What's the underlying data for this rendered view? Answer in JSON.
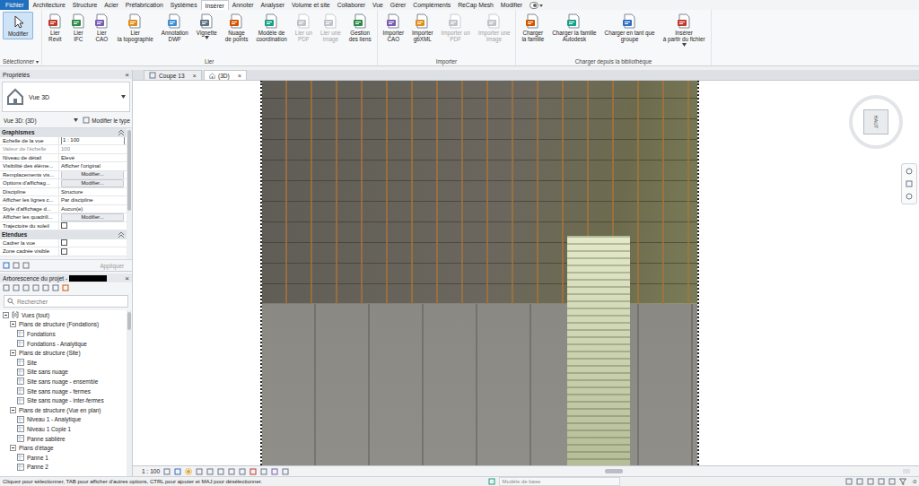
{
  "window": {
    "app": "Revit"
  },
  "menu_tabs": [
    {
      "label": "Fichier",
      "kind": "file",
      "selected": false
    },
    {
      "label": "Architecture",
      "kind": "tab",
      "selected": false
    },
    {
      "label": "Structure",
      "kind": "tab",
      "selected": false
    },
    {
      "label": "Acier",
      "kind": "tab",
      "selected": false
    },
    {
      "label": "Préfabrication",
      "kind": "tab",
      "selected": false
    },
    {
      "label": "Systèmes",
      "kind": "tab",
      "selected": false
    },
    {
      "label": "Insérer",
      "kind": "tab",
      "selected": true
    },
    {
      "label": "Annoter",
      "kind": "tab",
      "selected": false
    },
    {
      "label": "Analyser",
      "kind": "tab",
      "selected": false
    },
    {
      "label": "Volume et site",
      "kind": "tab",
      "selected": false
    },
    {
      "label": "Collaborer",
      "kind": "tab",
      "selected": false
    },
    {
      "label": "Vue",
      "kind": "tab",
      "selected": false
    },
    {
      "label": "Gérer",
      "kind": "tab",
      "selected": false
    },
    {
      "label": "Compléments",
      "kind": "tab",
      "selected": false
    },
    {
      "label": "ReCap Mesh",
      "kind": "tab",
      "selected": false
    },
    {
      "label": "Modifier",
      "kind": "tab",
      "selected": false
    }
  ],
  "ribbon": {
    "panels": [
      {
        "label": "Sélectionner ▾",
        "buttons": [
          {
            "lines": [
              "Modifier"
            ],
            "selected": true,
            "disabled": false,
            "dropdown": false
          }
        ]
      },
      {
        "label": "Lier",
        "buttons": [
          {
            "lines": [
              "Lier",
              "Revit"
            ],
            "selected": false,
            "disabled": false,
            "dropdown": false
          },
          {
            "lines": [
              "Lier",
              "IFC"
            ],
            "selected": false,
            "disabled": false,
            "dropdown": false
          },
          {
            "lines": [
              "Lier",
              "CAO"
            ],
            "selected": false,
            "disabled": false,
            "dropdown": false
          },
          {
            "lines": [
              "Lier",
              "la topographie"
            ],
            "selected": false,
            "disabled": false,
            "dropdown": false
          },
          {
            "lines": [
              "Annotation",
              "DWF"
            ],
            "selected": false,
            "disabled": false,
            "dropdown": false
          },
          {
            "lines": [
              "Vignette"
            ],
            "selected": false,
            "disabled": false,
            "dropdown": true
          },
          {
            "lines": [
              "Nuage",
              "de points"
            ],
            "selected": false,
            "disabled": false,
            "dropdown": false
          },
          {
            "lines": [
              "Modèle de",
              "coordination"
            ],
            "selected": false,
            "disabled": false,
            "dropdown": false
          },
          {
            "lines": [
              "Lier un",
              "PDF"
            ],
            "selected": false,
            "disabled": true,
            "dropdown": false
          },
          {
            "lines": [
              "Lier une",
              "image"
            ],
            "selected": false,
            "disabled": true,
            "dropdown": false
          },
          {
            "lines": [
              "Gestion",
              "des liens"
            ],
            "selected": false,
            "disabled": false,
            "dropdown": false
          }
        ]
      },
      {
        "label": "Importer",
        "buttons": [
          {
            "lines": [
              "Importer",
              "CAO"
            ],
            "selected": false,
            "disabled": false,
            "dropdown": false
          },
          {
            "lines": [
              "Importer",
              "gbXML"
            ],
            "selected": false,
            "disabled": false,
            "dropdown": false
          },
          {
            "lines": [
              "Importer un",
              "PDF"
            ],
            "selected": false,
            "disabled": true,
            "dropdown": false
          },
          {
            "lines": [
              "Importer une",
              "image"
            ],
            "selected": false,
            "disabled": true,
            "dropdown": false
          }
        ]
      },
      {
        "label": "Charger depuis la bibliothèque",
        "buttons": [
          {
            "lines": [
              "Charger",
              "la famille"
            ],
            "selected": false,
            "disabled": false,
            "dropdown": false
          },
          {
            "lines": [
              "Charger la famille",
              "Autodesk"
            ],
            "selected": false,
            "disabled": false,
            "dropdown": false
          },
          {
            "lines": [
              "Charger en tant que",
              "groupe"
            ],
            "selected": false,
            "disabled": false,
            "dropdown": false
          },
          {
            "lines": [
              "Insérer",
              "à partir du fichier"
            ],
            "selected": false,
            "disabled": false,
            "dropdown": true
          }
        ]
      }
    ]
  },
  "properties": {
    "title": "Propriétés",
    "close": "×",
    "type_name": "Vue 3D",
    "view_selector": "Vue 3D: (3D)",
    "edit_type": "Modifier le type",
    "sections": [
      {
        "label": "Graphismes",
        "rows": [
          {
            "kind": "input",
            "label": "Echelle de la vue",
            "value": "1 : 100",
            "disabled": false
          },
          {
            "kind": "text",
            "label": "Valeur de l'échelle",
            "value": "100",
            "disabled": true
          },
          {
            "kind": "text",
            "label": "Niveau de détail",
            "value": "Elevé",
            "disabled": false
          },
          {
            "kind": "text",
            "label": "Visibilité des éléme...",
            "value": "Afficher l'original",
            "disabled": false
          },
          {
            "kind": "button",
            "label": "Remplacements vis...",
            "value": "Modifier...",
            "disabled": false
          },
          {
            "kind": "button",
            "label": "Options d'affichag...",
            "value": "Modifier...",
            "disabled": false
          },
          {
            "kind": "text",
            "label": "Discipline",
            "value": "Structure",
            "disabled": false
          },
          {
            "kind": "text",
            "label": "Afficher les lignes c...",
            "value": "Par discipline",
            "disabled": false
          },
          {
            "kind": "text",
            "label": "Style d'affichage d...",
            "value": "Aucun(e)",
            "disabled": false
          },
          {
            "kind": "button",
            "label": "Afficher les quadrill...",
            "value": "Modifier...",
            "disabled": false
          },
          {
            "kind": "checkbox",
            "label": "Trajectoire du soleil",
            "checked": false,
            "disabled": false
          }
        ]
      },
      {
        "label": "Etendues",
        "rows": [
          {
            "kind": "checkbox",
            "label": "Cadrer la vue",
            "checked": false,
            "disabled": false
          },
          {
            "kind": "checkbox",
            "label": "Zone cadrée visible",
            "checked": false,
            "disabled": false
          }
        ]
      }
    ],
    "apply": "Appliquer",
    "apply_disabled": true
  },
  "project_browser": {
    "title": "Arborescence du projet -",
    "close": "×",
    "search_placeholder": "Rechercher",
    "tree": [
      {
        "label": "Vues (tout)",
        "depth": 0,
        "kind": "root",
        "expanded": true
      },
      {
        "label": "Plans de structure (Fondations)",
        "depth": 1,
        "kind": "group",
        "expanded": true
      },
      {
        "label": "Fondations",
        "depth": 2,
        "kind": "view",
        "expanded": false
      },
      {
        "label": "Fondations - Analytique",
        "depth": 2,
        "kind": "view",
        "expanded": false
      },
      {
        "label": "Plans de structure (Site)",
        "depth": 1,
        "kind": "group",
        "expanded": true
      },
      {
        "label": "Site",
        "depth": 2,
        "kind": "view",
        "expanded": false
      },
      {
        "label": "Site sans nuage",
        "depth": 2,
        "kind": "view",
        "expanded": false
      },
      {
        "label": "Site sans nuage - ensemble",
        "depth": 2,
        "kind": "view",
        "expanded": false
      },
      {
        "label": "Site sans nuage - fermes",
        "depth": 2,
        "kind": "view",
        "expanded": false
      },
      {
        "label": "Site sans nuage - inter-fermes",
        "depth": 2,
        "kind": "view",
        "expanded": false
      },
      {
        "label": "Plans de structure (Vue en plan)",
        "depth": 1,
        "kind": "group",
        "expanded": true
      },
      {
        "label": "Niveau 1 - Analytique",
        "depth": 2,
        "kind": "view",
        "expanded": false
      },
      {
        "label": "Niveau 1 Copie 1",
        "depth": 2,
        "kind": "view",
        "expanded": false
      },
      {
        "label": "Panne sablière",
        "depth": 2,
        "kind": "view",
        "expanded": false
      },
      {
        "label": "Plans d'étage",
        "depth": 1,
        "kind": "group",
        "expanded": true
      },
      {
        "label": "Panne 1",
        "depth": 2,
        "kind": "view",
        "expanded": false
      },
      {
        "label": "Panne 2",
        "depth": 2,
        "kind": "view",
        "expanded": false
      }
    ]
  },
  "view_tabs": [
    {
      "label": "Coupe 13",
      "selected": false,
      "close": "×"
    },
    {
      "label": "(3D)",
      "selected": true,
      "close": "×"
    }
  ],
  "viewcube": {
    "face": "HAUT"
  },
  "view_bar": {
    "scale": "1 : 100"
  },
  "status_bar": {
    "message": "Cliquez pour sélectionner, TAB pour afficher d'autres options, CTRL pour ajouter et MAJ pour désélectionner.",
    "model": "Modèle de base",
    "filter": ":0"
  }
}
